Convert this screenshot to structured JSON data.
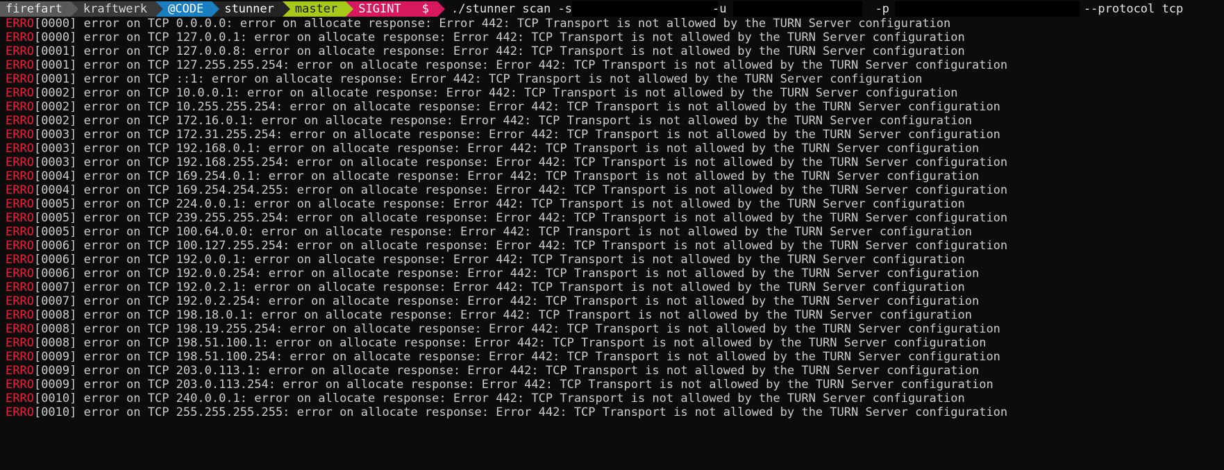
{
  "prompt": {
    "user": "firefart",
    "host": "kraftwerk",
    "tag": "@CODE",
    "dir": "stunner",
    "branch": "master",
    "signal": "SIGINT",
    "symbol": "$",
    "command": {
      "part1": "./stunner scan -s",
      "part2": "-u",
      "part3": "-p",
      "part4": "--protocol tcp"
    }
  },
  "log": [
    {
      "level": "ERRO",
      "ts": "[0000]",
      "msg": " error on TCP 0.0.0.0: error on allocate response: Error 442: TCP Transport is not allowed by the TURN Server configuration"
    },
    {
      "level": "ERRO",
      "ts": "[0000]",
      "msg": " error on TCP 127.0.0.1: error on allocate response: Error 442: TCP Transport is not allowed by the TURN Server configuration"
    },
    {
      "level": "ERRO",
      "ts": "[0001]",
      "msg": " error on TCP 127.0.0.8: error on allocate response: Error 442: TCP Transport is not allowed by the TURN Server configuration"
    },
    {
      "level": "ERRO",
      "ts": "[0001]",
      "msg": " error on TCP 127.255.255.254: error on allocate response: Error 442: TCP Transport is not allowed by the TURN Server configuration"
    },
    {
      "level": "ERRO",
      "ts": "[0001]",
      "msg": " error on TCP ::1: error on allocate response: Error 442: TCP Transport is not allowed by the TURN Server configuration"
    },
    {
      "level": "ERRO",
      "ts": "[0002]",
      "msg": " error on TCP 10.0.0.1: error on allocate response: Error 442: TCP Transport is not allowed by the TURN Server configuration"
    },
    {
      "level": "ERRO",
      "ts": "[0002]",
      "msg": " error on TCP 10.255.255.254: error on allocate response: Error 442: TCP Transport is not allowed by the TURN Server configuration"
    },
    {
      "level": "ERRO",
      "ts": "[0002]",
      "msg": " error on TCP 172.16.0.1: error on allocate response: Error 442: TCP Transport is not allowed by the TURN Server configuration"
    },
    {
      "level": "ERRO",
      "ts": "[0003]",
      "msg": " error on TCP 172.31.255.254: error on allocate response: Error 442: TCP Transport is not allowed by the TURN Server configuration"
    },
    {
      "level": "ERRO",
      "ts": "[0003]",
      "msg": " error on TCP 192.168.0.1: error on allocate response: Error 442: TCP Transport is not allowed by the TURN Server configuration"
    },
    {
      "level": "ERRO",
      "ts": "[0003]",
      "msg": " error on TCP 192.168.255.254: error on allocate response: Error 442: TCP Transport is not allowed by the TURN Server configuration"
    },
    {
      "level": "ERRO",
      "ts": "[0004]",
      "msg": " error on TCP 169.254.0.1: error on allocate response: Error 442: TCP Transport is not allowed by the TURN Server configuration"
    },
    {
      "level": "ERRO",
      "ts": "[0004]",
      "msg": " error on TCP 169.254.254.255: error on allocate response: Error 442: TCP Transport is not allowed by the TURN Server configuration"
    },
    {
      "level": "ERRO",
      "ts": "[0005]",
      "msg": " error on TCP 224.0.0.1: error on allocate response: Error 442: TCP Transport is not allowed by the TURN Server configuration"
    },
    {
      "level": "ERRO",
      "ts": "[0005]",
      "msg": " error on TCP 239.255.255.254: error on allocate response: Error 442: TCP Transport is not allowed by the TURN Server configuration"
    },
    {
      "level": "ERRO",
      "ts": "[0005]",
      "msg": " error on TCP 100.64.0.0: error on allocate response: Error 442: TCP Transport is not allowed by the TURN Server configuration"
    },
    {
      "level": "ERRO",
      "ts": "[0006]",
      "msg": " error on TCP 100.127.255.254: error on allocate response: Error 442: TCP Transport is not allowed by the TURN Server configuration"
    },
    {
      "level": "ERRO",
      "ts": "[0006]",
      "msg": " error on TCP 192.0.0.1: error on allocate response: Error 442: TCP Transport is not allowed by the TURN Server configuration"
    },
    {
      "level": "ERRO",
      "ts": "[0006]",
      "msg": " error on TCP 192.0.0.254: error on allocate response: Error 442: TCP Transport is not allowed by the TURN Server configuration"
    },
    {
      "level": "ERRO",
      "ts": "[0007]",
      "msg": " error on TCP 192.0.2.1: error on allocate response: Error 442: TCP Transport is not allowed by the TURN Server configuration"
    },
    {
      "level": "ERRO",
      "ts": "[0007]",
      "msg": " error on TCP 192.0.2.254: error on allocate response: Error 442: TCP Transport is not allowed by the TURN Server configuration"
    },
    {
      "level": "ERRO",
      "ts": "[0008]",
      "msg": " error on TCP 198.18.0.1: error on allocate response: Error 442: TCP Transport is not allowed by the TURN Server configuration"
    },
    {
      "level": "ERRO",
      "ts": "[0008]",
      "msg": " error on TCP 198.19.255.254: error on allocate response: Error 442: TCP Transport is not allowed by the TURN Server configuration"
    },
    {
      "level": "ERRO",
      "ts": "[0008]",
      "msg": " error on TCP 198.51.100.1: error on allocate response: Error 442: TCP Transport is not allowed by the TURN Server configuration"
    },
    {
      "level": "ERRO",
      "ts": "[0009]",
      "msg": " error on TCP 198.51.100.254: error on allocate response: Error 442: TCP Transport is not allowed by the TURN Server configuration"
    },
    {
      "level": "ERRO",
      "ts": "[0009]",
      "msg": " error on TCP 203.0.113.1: error on allocate response: Error 442: TCP Transport is not allowed by the TURN Server configuration"
    },
    {
      "level": "ERRO",
      "ts": "[0009]",
      "msg": " error on TCP 203.0.113.254: error on allocate response: Error 442: TCP Transport is not allowed by the TURN Server configuration"
    },
    {
      "level": "ERRO",
      "ts": "[0010]",
      "msg": " error on TCP 240.0.0.1: error on allocate response: Error 442: TCP Transport is not allowed by the TURN Server configuration"
    },
    {
      "level": "ERRO",
      "ts": "[0010]",
      "msg": " error on TCP 255.255.255.255: error on allocate response: Error 442: TCP Transport is not allowed by the TURN Server configuration"
    }
  ]
}
